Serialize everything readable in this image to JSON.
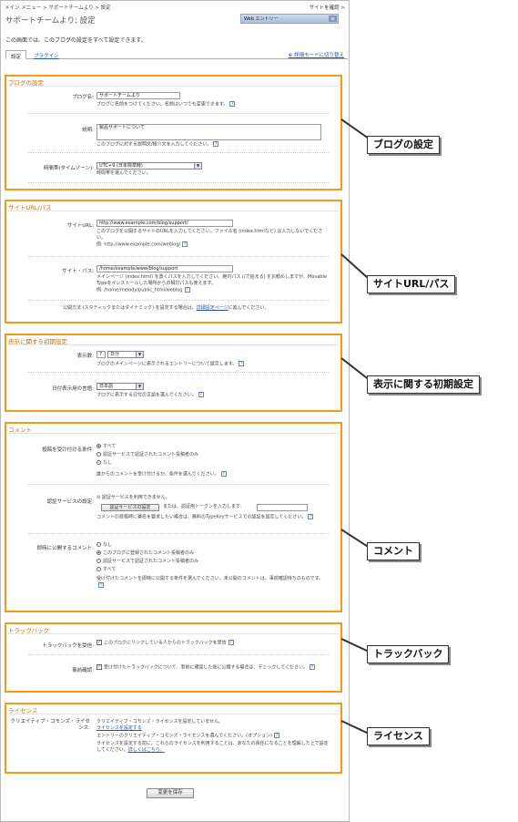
{
  "topbar": {
    "breadcrumb": "メイン メニュー > サポートチームより > 設定",
    "site_link": "サイトを確認 >"
  },
  "title": "サポートチームより: 設定",
  "search": {
    "value": "Web エントリー",
    "button": "≡"
  },
  "intro": "この画面では、このブログの設定をすべて設定できます。",
  "tabs": {
    "settings": "設定",
    "plugins": "プラグイン",
    "advanced_mode": "詳細モードに切り替え"
  },
  "blog": {
    "header": "ブログの設定",
    "name_label": "ブログ名:",
    "name_value": "サポートチームより",
    "name_hint": "ブログに名前をつけてください。名前はいつでも変更できます。",
    "desc_label": "説明:",
    "desc_value": "製品サポートについて",
    "desc_hint": "このブログに対する説明文/紹介文を入力してください。",
    "tz_label": "時間帯(タイムゾーン):",
    "tz_value": "UTC+9 (日本標準時)",
    "tz_hint": "時間帯を選んでください。"
  },
  "site": {
    "header": "サイトURL/パス",
    "url_label": "サイトURL:",
    "url_value": "http://www.example.com/blog/support/",
    "url_hint1": "このブログを公開するサイトのURLを入力してください。ファイル名 (index.htmlなど) は入力しないでください。",
    "url_hint2": "例: http://www.example.com/weblog/",
    "path_label": "サイト・パス:",
    "path_value": "/home/example/www/blog/support",
    "path_hint1": "メインページ (index.html) を置くパスを入力してください。絶対パス (/で始まる) をお勧めしますが、Movable Typeをインストールした場所からの相対パスも使えます。",
    "path_hint2": "例: /home/melody/public_html/weblog",
    "publish_note": "公開方法 (スタティックまたはダイナミック) を設定する場合は、",
    "publish_link": "詳細設定ページ",
    "publish_tail": "に進んでください。"
  },
  "display": {
    "header": "表示に関する初期設定",
    "count_label": "表示数:",
    "count_value": "7",
    "unit_value": "日分",
    "count_hint": "ブログのメインページに表示されるエントリーについて設定します。",
    "lang_label": "日付表示用の言語:",
    "lang_value": "日本語",
    "lang_hint": "ブログに表示する日付の言語を選んでください。"
  },
  "comments": {
    "header": "コメント",
    "accept_label": "投稿を受け付ける条件:",
    "accept_opts": [
      "すべて",
      "認証サービスで認証されたコメント投稿者のみ",
      "なし"
    ],
    "accept_hint": "誰からのコメントを受け付けるか、条件を選んでください。",
    "auth_label": "認証サービスの設定:",
    "auth_status": "認証サービスを利用できません。",
    "auth_button": "認証サービスの設定",
    "auth_or": "または、認証用トークンを入力します:",
    "auth_hint": "コメントの投稿時に署名を要求したい場合は、無料のTypeKeyサービスでの認証を設定してください。",
    "immediate_label": "即時に公開するコメント:",
    "immediate_opts": [
      "なし",
      "このブログに登録されたコメント投稿者のみ",
      "認証サービスで認証されたコメント投稿者のみ",
      "すべて"
    ],
    "immediate_hint": "受け付けたコメントを即時に公開する条件を選んでください。未公開のコメントは、事前確認待ちのものです。"
  },
  "trackback": {
    "header": "トラックバック",
    "accept_label": "トラックバックを受信:",
    "accept_text": "このブログにリンクしている人からのトラックバックを受信",
    "moderate_label": "事前確認:",
    "moderate_text": "受け付けたトラックバックについて、事前に確認した後に公開する場合は、チェックしてください。"
  },
  "license": {
    "header": "ライセンス",
    "label": "クリエイティブ・コモンズ・ライセンス:",
    "status": "クリエイティブ・コモンズ・ライセンスを設定していません。",
    "link": "ライセンスを設定する",
    "hint1": "エントリーのクリエイティブ・コモンズ・ライセンスを選んでください。(オプション)",
    "hint2": "ライセンスを設定する前に、これらのライセンスを利用することは、あなたの責任になることを理解した上で設定してください。",
    "more": "詳しくはこちら。"
  },
  "save_button": "変更を保存",
  "callouts": [
    "ブログの設定",
    "サイトURL/パス",
    "表示に関する初期設定",
    "コメント",
    "トラックバック",
    "ライセンス"
  ],
  "icons": {
    "help": "?",
    "check": "✓",
    "arrow": "▼"
  },
  "colors": {
    "callout_border": "#f29a1b",
    "link": "#2255aa"
  }
}
